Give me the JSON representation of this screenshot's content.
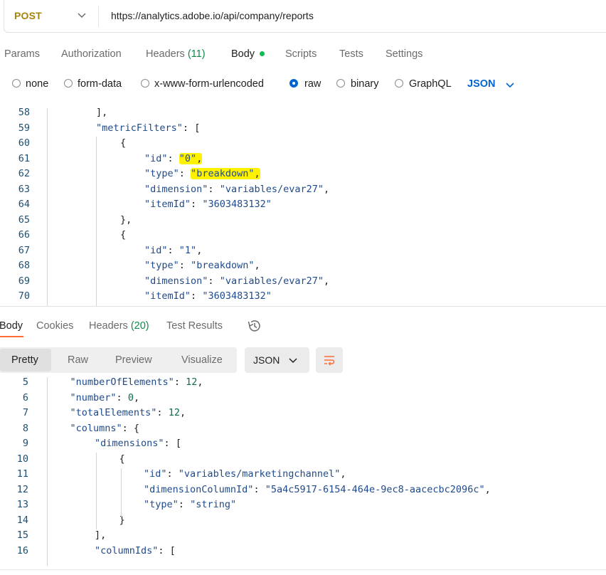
{
  "request": {
    "method": "POST",
    "url": "https://analytics.adobe.io/api/company/reports"
  },
  "request_tabs": {
    "params": "Params",
    "authorization": "Authorization",
    "headers": "Headers",
    "headers_count": "(11)",
    "body": "Body",
    "scripts": "Scripts",
    "tests": "Tests",
    "settings": "Settings"
  },
  "body_types": {
    "none": "none",
    "form_data": "form-data",
    "urlencoded": "x-www-form-urlencoded",
    "raw": "raw",
    "binary": "binary",
    "graphql": "GraphQL",
    "language": "JSON",
    "selected": "raw"
  },
  "request_editor": {
    "lines": [
      {
        "n": "58",
        "t": "],"
      },
      {
        "n": "59",
        "t": "\"metricFilters\": ["
      },
      {
        "n": "60",
        "t": "{"
      },
      {
        "n": "61",
        "t": "\"id\": \"0\","
      },
      {
        "n": "62",
        "t": "\"type\": \"breakdown\","
      },
      {
        "n": "63",
        "t": "\"dimension\": \"variables/evar27\","
      },
      {
        "n": "64",
        "t": "\"itemId\": \"3603483132\""
      },
      {
        "n": "65",
        "t": "},"
      },
      {
        "n": "66",
        "t": "{"
      },
      {
        "n": "67",
        "t": "\"id\": \"1\","
      },
      {
        "n": "68",
        "t": "\"type\": \"breakdown\","
      },
      {
        "n": "69",
        "t": "\"dimension\": \"variables/evar27\","
      },
      {
        "n": "70",
        "t": "\"itemId\": \"3603483132\""
      }
    ]
  },
  "response_tabs": {
    "body": "Body",
    "cookies": "Cookies",
    "headers": "Headers",
    "headers_count": "(20)",
    "test_results": "Test Results"
  },
  "response_view": {
    "pretty": "Pretty",
    "raw": "Raw",
    "preview": "Preview",
    "visualize": "Visualize",
    "format": "JSON"
  },
  "response_editor": {
    "lines": [
      {
        "n": "5",
        "t": "\"numberOfElements\": 12,"
      },
      {
        "n": "6",
        "t": "\"number\": 0,"
      },
      {
        "n": "7",
        "t": "\"totalElements\": 12,"
      },
      {
        "n": "8",
        "t": "\"columns\": {"
      },
      {
        "n": "9",
        "t": "\"dimensions\": ["
      },
      {
        "n": "10",
        "t": "{"
      },
      {
        "n": "11",
        "t": "\"id\": \"variables/marketingchannel\","
      },
      {
        "n": "12",
        "t": "\"dimensionColumnId\": \"5a4c5917-6154-464e-9ec8-aacecbc2096c\","
      },
      {
        "n": "13",
        "t": "\"type\": \"string\""
      },
      {
        "n": "14",
        "t": "}"
      },
      {
        "n": "15",
        "t": "],"
      },
      {
        "n": "16",
        "t": "\"columnIds\": ["
      }
    ]
  },
  "icons": {
    "method_dropdown": "chevron-down-icon",
    "history": "history-icon",
    "wrap": "wrap-lines-icon"
  },
  "colors": {
    "method": "#a8820a",
    "accent_blue": "#0265d2",
    "highlight": "#fff200",
    "active_dot": "#0cbb52",
    "orange": "#ff6c37"
  }
}
